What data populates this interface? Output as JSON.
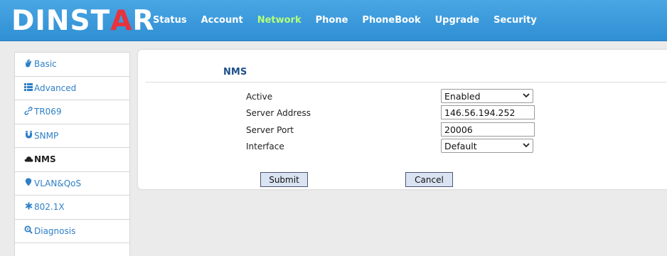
{
  "brand": {
    "logo_prefix": "DINST",
    "logo_accent": "A",
    "logo_suffix": "R"
  },
  "nav": {
    "items": [
      "Status",
      "Account",
      "Network",
      "Phone",
      "PhoneBook",
      "Upgrade",
      "Security"
    ],
    "active": "Network"
  },
  "sidebar": {
    "items": [
      {
        "label": "Basic",
        "icon": "hand-icon"
      },
      {
        "label": "Advanced",
        "icon": "list-icon"
      },
      {
        "label": "TR069",
        "icon": "link-icon"
      },
      {
        "label": "SNMP",
        "icon": "magnet-icon"
      },
      {
        "label": "NMS",
        "icon": "cloud-icon"
      },
      {
        "label": "VLAN&QoS",
        "icon": "pin-icon"
      },
      {
        "label": "802.1X",
        "icon": "asterisk-icon"
      },
      {
        "label": "Diagnosis",
        "icon": "magnifier-icon"
      }
    ],
    "active": "NMS"
  },
  "nms": {
    "title": "NMS",
    "active_label": "Active",
    "active_value": "Enabled",
    "server_address_label": "Server Address",
    "server_address_value": "146.56.194.252",
    "server_port_label": "Server Port",
    "server_port_value": "20006",
    "interface_label": "Interface",
    "interface_value": "Default",
    "submit_label": "Submit",
    "cancel_label": "Cancel"
  },
  "colors": {
    "header": "#3b9ddd",
    "nav_active": "#b3ff7a",
    "sidebar_link": "#2e7fc7",
    "section_title": "#1f4f8a"
  }
}
